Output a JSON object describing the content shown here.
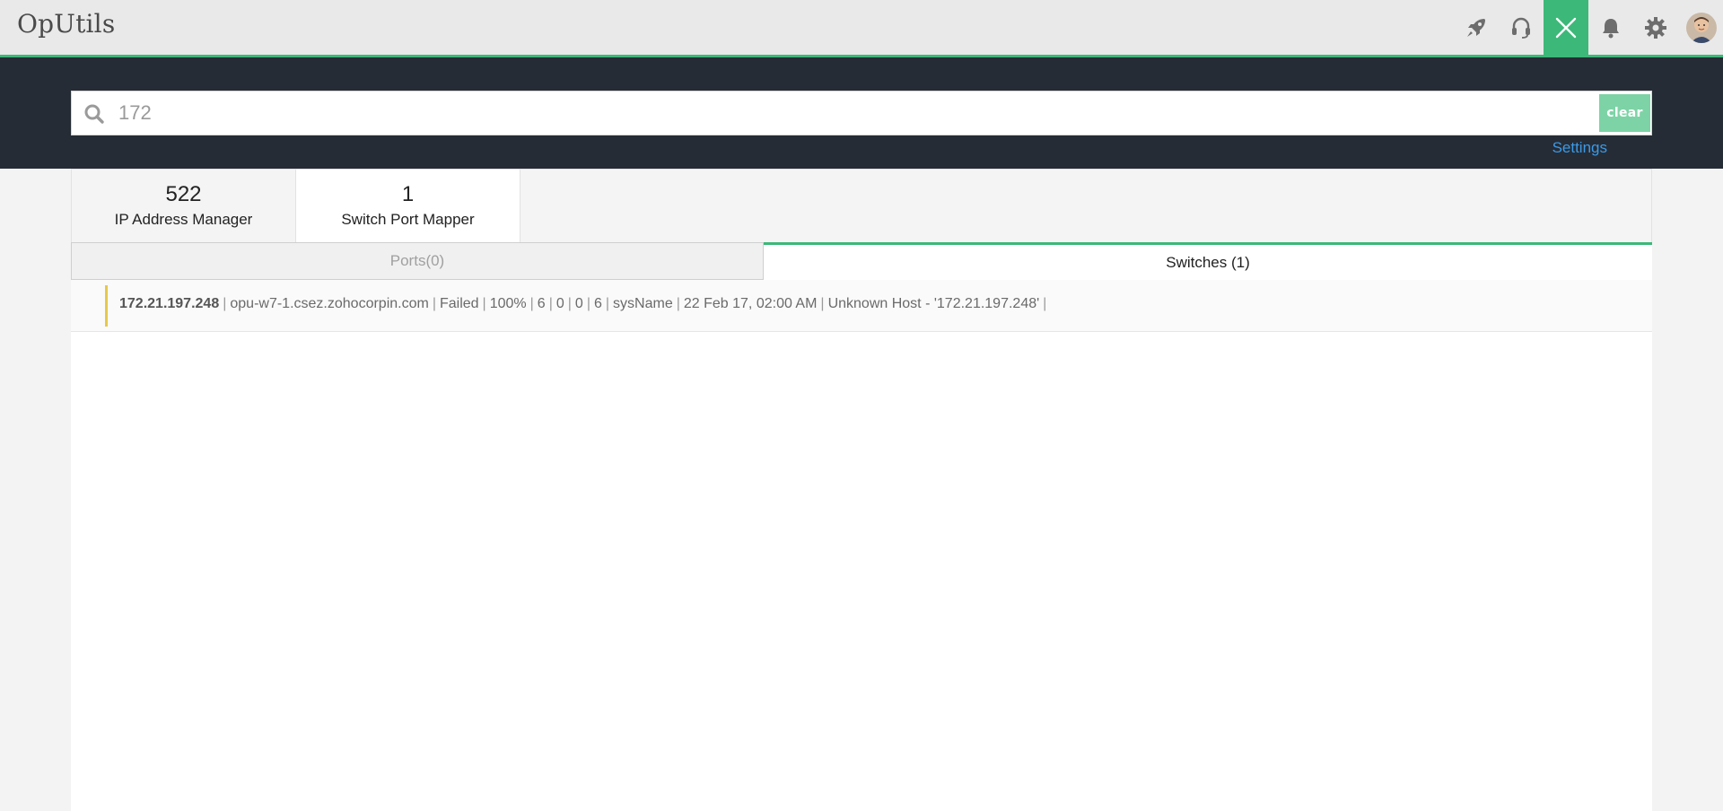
{
  "header": {
    "brand": "OpUtils",
    "icons": [
      "rocket-icon",
      "headset-icon",
      "close-icon",
      "bell-icon",
      "gear-icon"
    ],
    "accent_color": "#3cb878"
  },
  "search": {
    "value": "172",
    "clear_label": "clear",
    "settings_label": "Settings"
  },
  "modules": [
    {
      "count": "522",
      "label": "IP Address Manager"
    },
    {
      "count": "1",
      "label": "Switch Port Mapper"
    }
  ],
  "subtabs": {
    "ports": "Ports(0)",
    "switches": "Switches (1)"
  },
  "result": {
    "ip": "172.21.197.248",
    "fields": [
      "opu-w7-1.csez.zohocorpin.com",
      "Failed",
      "100%",
      "6",
      "0",
      "0",
      "6",
      "sysName",
      "22 Feb 17, 02:00 AM",
      "Unknown Host - '172.21.197.248'"
    ]
  }
}
